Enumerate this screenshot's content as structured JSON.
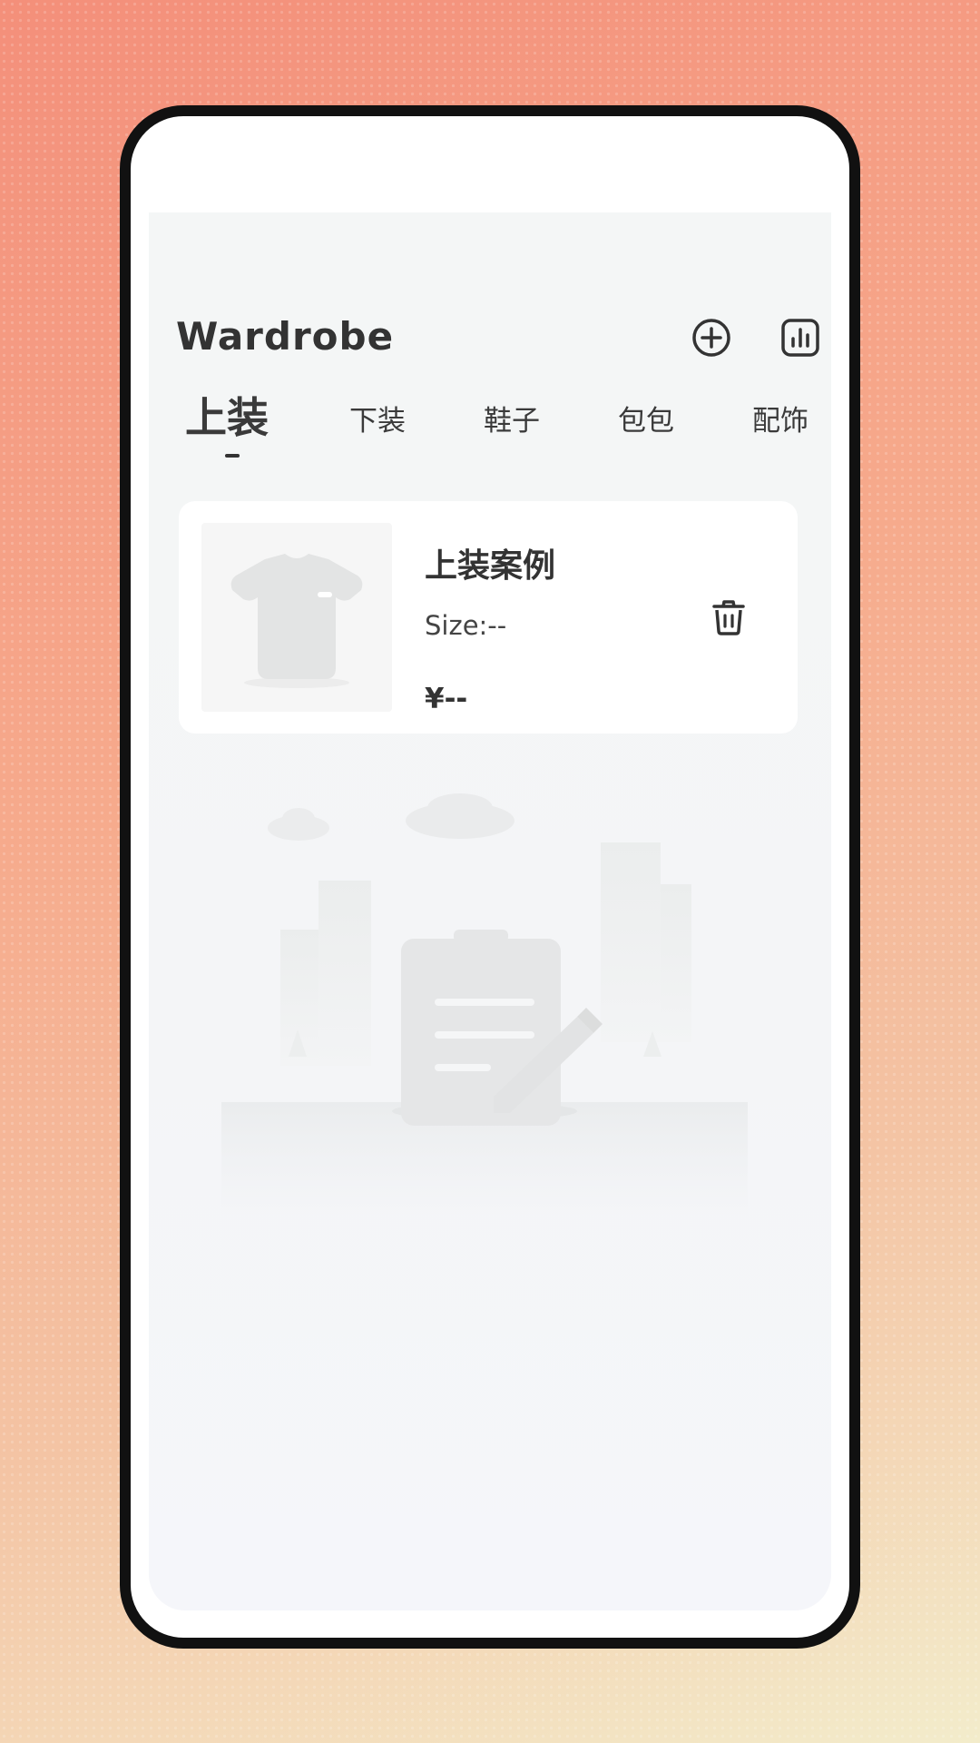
{
  "app": {
    "title": "Wardrobe"
  },
  "header": {
    "add_icon": "plus-circle-icon",
    "stats_icon": "bar-chart-icon"
  },
  "tabs": [
    {
      "label": "上装",
      "active": true
    },
    {
      "label": "下装",
      "active": false
    },
    {
      "label": "鞋子",
      "active": false
    },
    {
      "label": "包包",
      "active": false
    },
    {
      "label": "配饰",
      "active": false
    }
  ],
  "items": [
    {
      "name": "上装案例",
      "size": "Size:--",
      "price": "¥--",
      "thumbnail_icon": "tshirt-icon",
      "delete_icon": "trash-icon"
    }
  ],
  "empty_state": {
    "illustration_icon": "clipboard-edit-icon"
  },
  "colors": {
    "text": "#333333",
    "card_bg": "#ffffff",
    "screen_bg": "#f4f6f6",
    "placeholder_gray": "#e3e4e4"
  }
}
